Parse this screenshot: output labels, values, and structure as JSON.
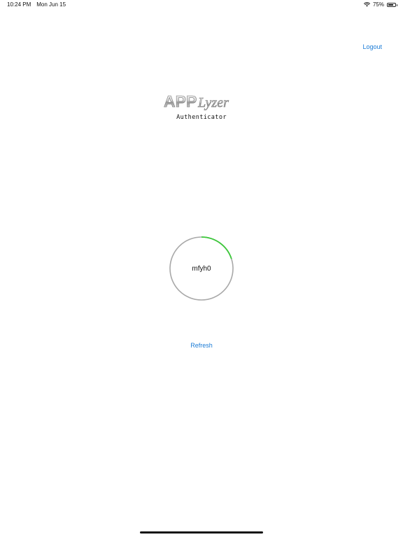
{
  "status_bar": {
    "time": "10:24 PM",
    "date": "Mon Jun 15",
    "battery": "75%",
    "battery_level": 0.75,
    "icons": [
      "wifi-icon",
      "battery-icon"
    ]
  },
  "header": {
    "logout_label": "Logout"
  },
  "logo": {
    "name_prefix": "APP",
    "name_suffix": "Lyzer",
    "subtitle": "Authenticator"
  },
  "code": {
    "value": "mfyh0",
    "progress": 0.2,
    "ring_color": "#a8a8a8",
    "progress_color": "#3cc83a"
  },
  "actions": {
    "refresh_label": "Refresh"
  },
  "colors": {
    "accent": "#1a7bd6"
  }
}
